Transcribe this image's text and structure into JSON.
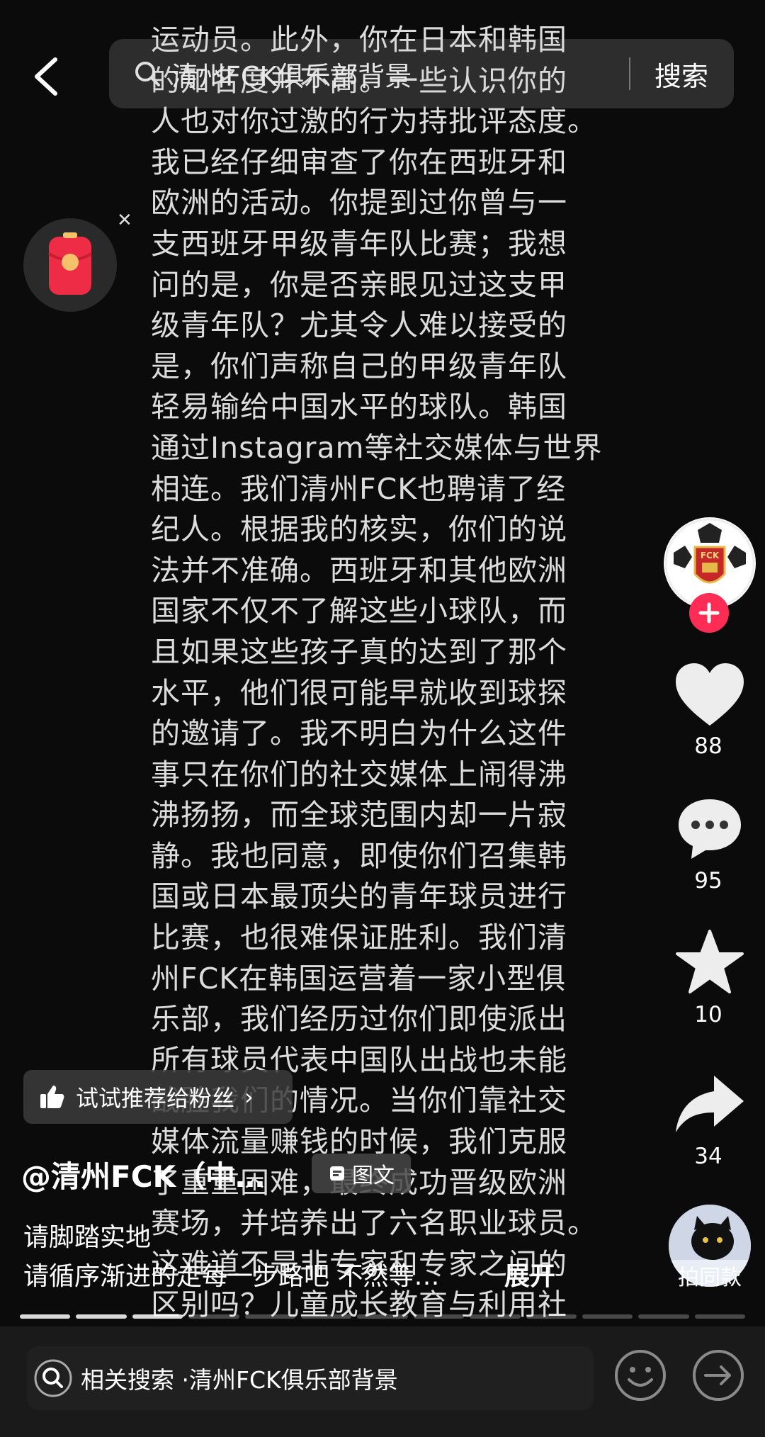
{
  "search": {
    "query": "清州FCK俱乐部背景",
    "button_label": "搜索"
  },
  "article_lines": [
    "运动员。此外，你在日本和韩国",
    "的知名度并不高。一些认识你的",
    "人也对你过激的行为持批评态度。",
    "我已经仔细审查了你在西班牙和",
    "欧洲的活动。你提到过你曾与一",
    "支西班牙甲级青年队比赛；我想",
    "问的是，你是否亲眼见过这支甲",
    "级青年队？尤其令人难以接受的",
    "是，你们声称自己的甲级青年队",
    "轻易输给中国水平的球队。韩国",
    "通过Instagram等社交媒体与世界",
    "相连。我们清州FCK也聘请了经",
    "纪人。根据我的核实，你们的说",
    "法并不准确。西班牙和其他欧洲",
    "国家不仅不了解这些小球队，而",
    "且如果这些孩子真的达到了那个",
    "水平，他们很可能早就收到球探",
    "的邀请了。我不明白为什么这件",
    "事只在你们的社交媒体上闹得沸",
    "沸扬扬，而全球范围内却一片寂",
    "静。我也同意，即使你们召集韩",
    "国或日本最顶尖的青年球员进行",
    "比赛，也很难保证胜利。我们清",
    "州FCK在韩国运营着一家小型俱",
    "乐部，我们经历过你们即使派出",
    "所有球员代表中国队出战也未能",
    "战胜我们的情况。当你们靠社交",
    "媒体流量赚钱的时候，我们克服",
    "了重重困难，最终成功晋级欧洲",
    "赛场，并培养出了六名职业球员。",
    "这难道不是非专家和专家之间的",
    "区别吗？儿童成长教育与利用社"
  ],
  "sidebar": {
    "likes": "88",
    "comments": "95",
    "favorites": "10",
    "shares": "34",
    "same_style_label": "拍同款",
    "avatar_badge": "FCK"
  },
  "recommend": {
    "label": "试试推荐给粉丝"
  },
  "author": {
    "name": "@清州FCK（中…",
    "tag": "图文"
  },
  "caption": {
    "line1": "请脚踏实地",
    "line2": "请循序渐进的走每一步路吧 不然等…",
    "expand": "展开"
  },
  "progress": {
    "total_segments": 13,
    "current_segment": 3
  },
  "bottom": {
    "related_prefix": "相关搜索 · ",
    "related_query": "清州FCK俱乐部背景"
  },
  "colors": {
    "accent": "#ff2c55",
    "background": "#0b0b0b",
    "envelope": "#ee2c45"
  },
  "icons": [
    "back-arrow-icon",
    "search-icon",
    "red-envelope-icon",
    "close-icon",
    "heart-icon",
    "comment-icon",
    "star-icon",
    "share-icon",
    "thumbs-up-icon",
    "chevron-right-icon",
    "emoji-icon",
    "send-icon",
    "plus-icon",
    "doc-icon"
  ]
}
